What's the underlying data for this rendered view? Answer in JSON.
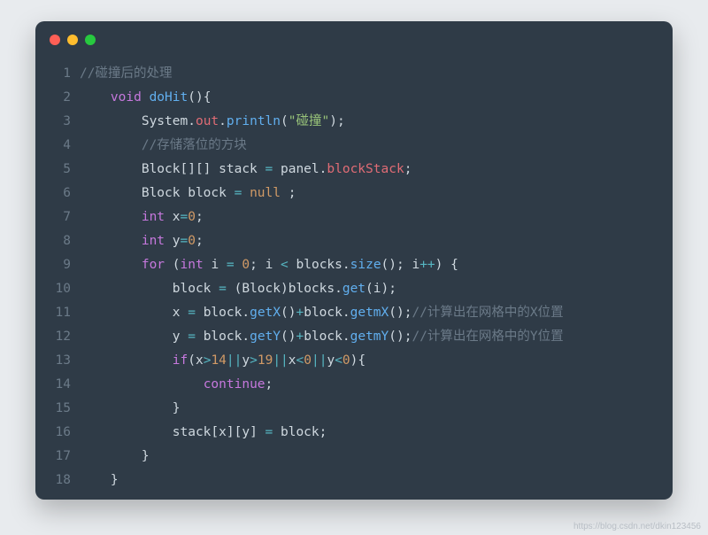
{
  "watermark": "https://blog.csdn.net/dkin123456",
  "window": {
    "dots": [
      "red",
      "yellow",
      "green"
    ]
  },
  "code": {
    "lines": [
      {
        "n": "1",
        "indent": "",
        "tokens": [
          {
            "t": "//碰撞后的处理",
            "c": "comment"
          }
        ]
      },
      {
        "n": "2",
        "indent": "    ",
        "tokens": [
          {
            "t": "void",
            "c": "keyword"
          },
          {
            "t": " ",
            "c": "punct"
          },
          {
            "t": "doHit",
            "c": "method"
          },
          {
            "t": "(){",
            "c": "punct"
          }
        ]
      },
      {
        "n": "3",
        "indent": "        ",
        "tokens": [
          {
            "t": "System",
            "c": "ident"
          },
          {
            "t": ".",
            "c": "punct"
          },
          {
            "t": "out",
            "c": "member"
          },
          {
            "t": ".",
            "c": "punct"
          },
          {
            "t": "println",
            "c": "method"
          },
          {
            "t": "(",
            "c": "punct"
          },
          {
            "t": "\"碰撞\"",
            "c": "string"
          },
          {
            "t": ");",
            "c": "punct"
          }
        ]
      },
      {
        "n": "4",
        "indent": "        ",
        "tokens": [
          {
            "t": "//存储落位的方块",
            "c": "comment"
          }
        ]
      },
      {
        "n": "5",
        "indent": "        ",
        "tokens": [
          {
            "t": "Block[][] stack ",
            "c": "ident"
          },
          {
            "t": "=",
            "c": "op"
          },
          {
            "t": " panel",
            "c": "ident"
          },
          {
            "t": ".",
            "c": "punct"
          },
          {
            "t": "blockStack",
            "c": "member"
          },
          {
            "t": ";",
            "c": "punct"
          }
        ]
      },
      {
        "n": "6",
        "indent": "        ",
        "tokens": [
          {
            "t": "Block block ",
            "c": "ident"
          },
          {
            "t": "=",
            "c": "op"
          },
          {
            "t": " ",
            "c": "punct"
          },
          {
            "t": "null",
            "c": "const"
          },
          {
            "t": " ;",
            "c": "punct"
          }
        ]
      },
      {
        "n": "7",
        "indent": "        ",
        "tokens": [
          {
            "t": "int",
            "c": "keyword"
          },
          {
            "t": " x",
            "c": "ident"
          },
          {
            "t": "=",
            "c": "op"
          },
          {
            "t": "0",
            "c": "number"
          },
          {
            "t": ";",
            "c": "punct"
          }
        ]
      },
      {
        "n": "8",
        "indent": "        ",
        "tokens": [
          {
            "t": "int",
            "c": "keyword"
          },
          {
            "t": " y",
            "c": "ident"
          },
          {
            "t": "=",
            "c": "op"
          },
          {
            "t": "0",
            "c": "number"
          },
          {
            "t": ";",
            "c": "punct"
          }
        ]
      },
      {
        "n": "9",
        "indent": "        ",
        "tokens": [
          {
            "t": "for",
            "c": "keyword"
          },
          {
            "t": " (",
            "c": "punct"
          },
          {
            "t": "int",
            "c": "keyword"
          },
          {
            "t": " i ",
            "c": "ident"
          },
          {
            "t": "=",
            "c": "op"
          },
          {
            "t": " ",
            "c": "punct"
          },
          {
            "t": "0",
            "c": "number"
          },
          {
            "t": "; i ",
            "c": "punct"
          },
          {
            "t": "<",
            "c": "op"
          },
          {
            "t": " blocks",
            "c": "ident"
          },
          {
            "t": ".",
            "c": "punct"
          },
          {
            "t": "size",
            "c": "method"
          },
          {
            "t": "(); i",
            "c": "punct"
          },
          {
            "t": "++",
            "c": "op"
          },
          {
            "t": ") {",
            "c": "punct"
          }
        ]
      },
      {
        "n": "10",
        "indent": "            ",
        "tokens": [
          {
            "t": "block ",
            "c": "ident"
          },
          {
            "t": "=",
            "c": "op"
          },
          {
            "t": " (Block)blocks",
            "c": "ident"
          },
          {
            "t": ".",
            "c": "punct"
          },
          {
            "t": "get",
            "c": "method"
          },
          {
            "t": "(i);",
            "c": "punct"
          }
        ]
      },
      {
        "n": "11",
        "indent": "            ",
        "tokens": [
          {
            "t": "x ",
            "c": "ident"
          },
          {
            "t": "=",
            "c": "op"
          },
          {
            "t": " block",
            "c": "ident"
          },
          {
            "t": ".",
            "c": "punct"
          },
          {
            "t": "getX",
            "c": "method"
          },
          {
            "t": "()",
            "c": "punct"
          },
          {
            "t": "+",
            "c": "op"
          },
          {
            "t": "block",
            "c": "ident"
          },
          {
            "t": ".",
            "c": "punct"
          },
          {
            "t": "getmX",
            "c": "method"
          },
          {
            "t": "();",
            "c": "punct"
          },
          {
            "t": "//计算出在网格中的X位置",
            "c": "comment"
          }
        ]
      },
      {
        "n": "12",
        "indent": "            ",
        "tokens": [
          {
            "t": "y ",
            "c": "ident"
          },
          {
            "t": "=",
            "c": "op"
          },
          {
            "t": " block",
            "c": "ident"
          },
          {
            "t": ".",
            "c": "punct"
          },
          {
            "t": "getY",
            "c": "method"
          },
          {
            "t": "()",
            "c": "punct"
          },
          {
            "t": "+",
            "c": "op"
          },
          {
            "t": "block",
            "c": "ident"
          },
          {
            "t": ".",
            "c": "punct"
          },
          {
            "t": "getmY",
            "c": "method"
          },
          {
            "t": "();",
            "c": "punct"
          },
          {
            "t": "//计算出在网格中的Y位置",
            "c": "comment"
          }
        ]
      },
      {
        "n": "13",
        "indent": "            ",
        "tokens": [
          {
            "t": "if",
            "c": "keyword"
          },
          {
            "t": "(x",
            "c": "punct"
          },
          {
            "t": ">",
            "c": "op"
          },
          {
            "t": "14",
            "c": "number"
          },
          {
            "t": "||",
            "c": "op"
          },
          {
            "t": "y",
            "c": "ident"
          },
          {
            "t": ">",
            "c": "op"
          },
          {
            "t": "19",
            "c": "number"
          },
          {
            "t": "||",
            "c": "op"
          },
          {
            "t": "x",
            "c": "ident"
          },
          {
            "t": "<",
            "c": "op"
          },
          {
            "t": "0",
            "c": "number"
          },
          {
            "t": "||",
            "c": "op"
          },
          {
            "t": "y",
            "c": "ident"
          },
          {
            "t": "<",
            "c": "op"
          },
          {
            "t": "0",
            "c": "number"
          },
          {
            "t": "){",
            "c": "punct"
          }
        ]
      },
      {
        "n": "14",
        "indent": "                ",
        "tokens": [
          {
            "t": "continue",
            "c": "keyword"
          },
          {
            "t": ";",
            "c": "punct"
          }
        ]
      },
      {
        "n": "15",
        "indent": "            ",
        "tokens": [
          {
            "t": "}",
            "c": "punct"
          }
        ]
      },
      {
        "n": "16",
        "indent": "            ",
        "tokens": [
          {
            "t": "stack[x][y] ",
            "c": "ident"
          },
          {
            "t": "=",
            "c": "op"
          },
          {
            "t": " block;",
            "c": "punct"
          }
        ]
      },
      {
        "n": "17",
        "indent": "        ",
        "tokens": [
          {
            "t": "}",
            "c": "punct"
          }
        ]
      },
      {
        "n": "18",
        "indent": "    ",
        "tokens": [
          {
            "t": "}",
            "c": "punct"
          }
        ]
      }
    ]
  }
}
